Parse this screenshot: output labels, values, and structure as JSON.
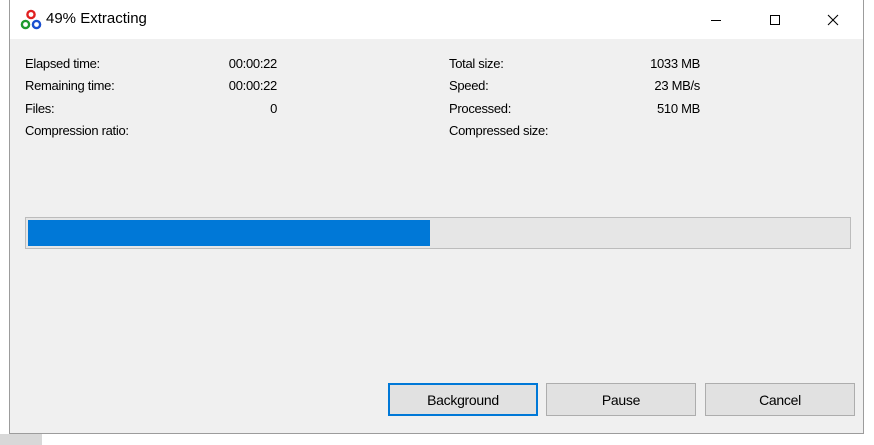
{
  "window": {
    "title": "49% Extracting",
    "icon": "7zip-app-icon",
    "controls": {
      "minimize": "minimize-icon",
      "maximize": "maximize-icon",
      "close": "close-icon"
    }
  },
  "stats": {
    "elapsed_label": "Elapsed time:",
    "elapsed_value": "00:00:22",
    "remaining_label": "Remaining time:",
    "remaining_value": "00:00:22",
    "files_label": "Files:",
    "files_value": "0",
    "ratio_label": "Compression ratio:",
    "ratio_value": "",
    "total_size_label": "Total size:",
    "total_size_value": "1033 MB",
    "speed_label": "Speed:",
    "speed_value": "23 MB/s",
    "processed_label": "Processed:",
    "processed_value": "510 MB",
    "compressed_size_label": "Compressed size:",
    "compressed_size_value": ""
  },
  "progress": {
    "percent": 49,
    "color": "#0078d7"
  },
  "buttons": {
    "background_label": "Background",
    "pause_label": "Pause",
    "cancel_label": "Cancel"
  }
}
